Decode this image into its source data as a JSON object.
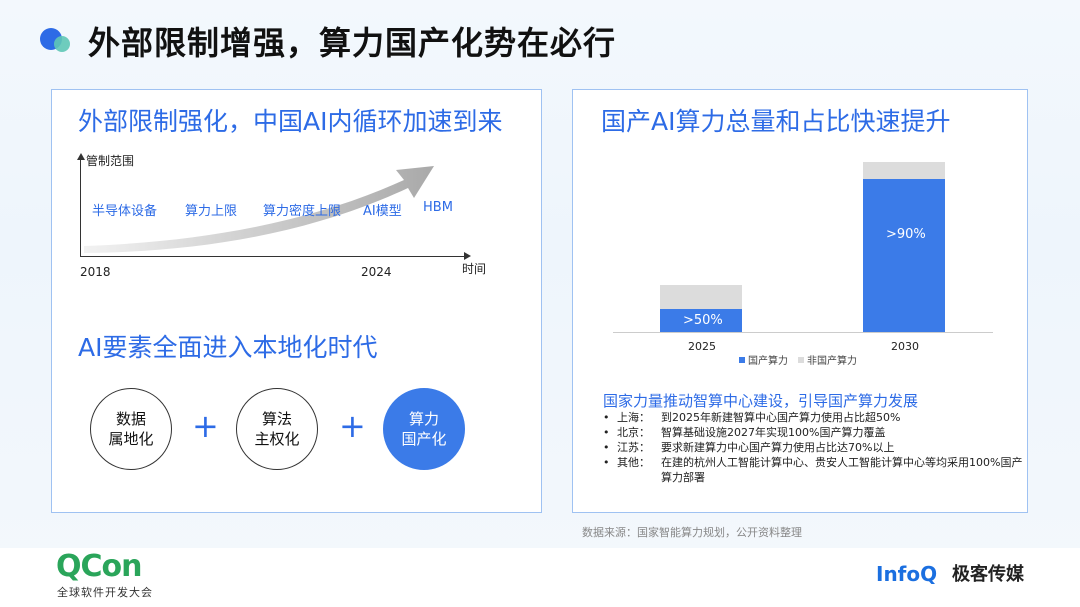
{
  "page_title": "外部限制增强，算力国产化势在必行",
  "left": {
    "heading": "外部限制强化，中国AI内循环加速到来",
    "y_axis_label": "管制范围",
    "x_axis_label": "时间",
    "x_start": "2018",
    "x_end": "2024",
    "items": [
      "半导体设备",
      "算力上限",
      "算力密度上限",
      "AI模型",
      "HBM"
    ],
    "heading2": "AI要素全面进入本地化时代",
    "circles": [
      {
        "line1": "数据",
        "line2": "属地化"
      },
      {
        "line1": "算法",
        "line2": "主权化"
      },
      {
        "line1": "算力",
        "line2": "国产化"
      }
    ],
    "plus": "+"
  },
  "right": {
    "heading": "国产AI算力总量和占比快速提升",
    "chart_data": {
      "type": "bar",
      "stacked": true,
      "categories": [
        "2025",
        "2030"
      ],
      "series": [
        {
          "name": "国产算力",
          "color": "#3b7be8",
          "values": [
            14,
            92
          ],
          "labels": [
            ">50%",
            ">90%"
          ]
        },
        {
          "name": "非国产算力",
          "color": "#dcdcdc",
          "values": [
            14,
            10
          ]
        }
      ],
      "ylim": [
        0,
        102
      ]
    },
    "sub_heading": "国家力量推动智算中心建设，引导国产算力发展",
    "bullet_symbol": "•",
    "bullets": [
      {
        "city": "上海：",
        "text": "到2025年新建智算中心国产算力使用占比超50%"
      },
      {
        "city": "北京：",
        "text": "智算基础设施2027年实现100%国产算力覆盖"
      },
      {
        "city": "江苏：",
        "text": "要求新建算力中心国产算力使用占比达70%以上"
      },
      {
        "city": "其他：",
        "text": "在建的杭州人工智能计算中心、贵安人工智能计算中心等均采用100%国产算力部署"
      }
    ]
  },
  "source": "数据来源：国家智能算力规划，公开资料整理",
  "footer": {
    "qcon": "QCon",
    "qcon_sub": "全球软件开发大会",
    "infoq": "InfoQ",
    "jike": "极客传媒"
  }
}
